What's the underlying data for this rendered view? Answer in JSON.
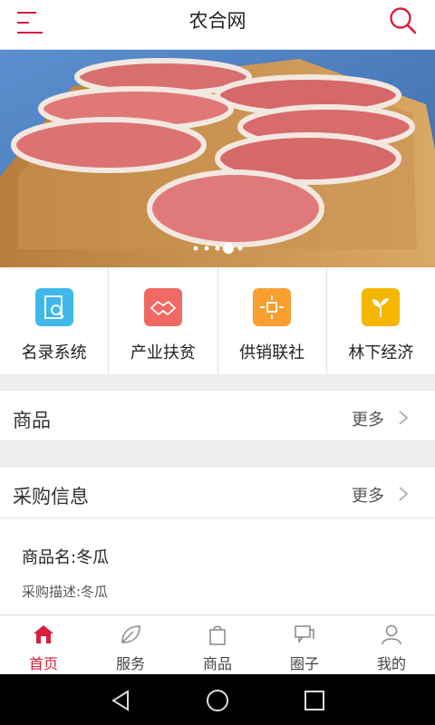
{
  "header": {
    "title": "农合网",
    "menu_icon": "menu-icon",
    "search_icon": "search-icon"
  },
  "banner": {
    "image": "sliced-pork-on-cutting-board",
    "slides": 5,
    "active_slide": 4
  },
  "categories": [
    {
      "label": "名录系统",
      "icon": "directory-icon",
      "color": "#3fb8ea"
    },
    {
      "label": "产业扶贫",
      "icon": "handshake-icon",
      "color": "#ef6a64"
    },
    {
      "label": "供销联社",
      "icon": "network-icon",
      "color": "#f7a030"
    },
    {
      "label": "林下经济",
      "icon": "sprout-icon",
      "color": "#f5b600"
    }
  ],
  "sections": {
    "goods": {
      "title": "商品",
      "more": "更多"
    },
    "purchase": {
      "title": "采购信息",
      "more": "更多"
    }
  },
  "purchase_item": {
    "name": "商品名:冬瓜",
    "description": "采购描述:冬瓜"
  },
  "tabbar": [
    {
      "label": "首页",
      "icon": "home-icon",
      "active": true
    },
    {
      "label": "服务",
      "icon": "leaf-icon",
      "active": false
    },
    {
      "label": "商品",
      "icon": "bag-icon",
      "active": false
    },
    {
      "label": "圈子",
      "icon": "chat-icon",
      "active": false
    },
    {
      "label": "我的",
      "icon": "user-icon",
      "active": false
    }
  ],
  "colors": {
    "accent": "#d81e3a"
  }
}
